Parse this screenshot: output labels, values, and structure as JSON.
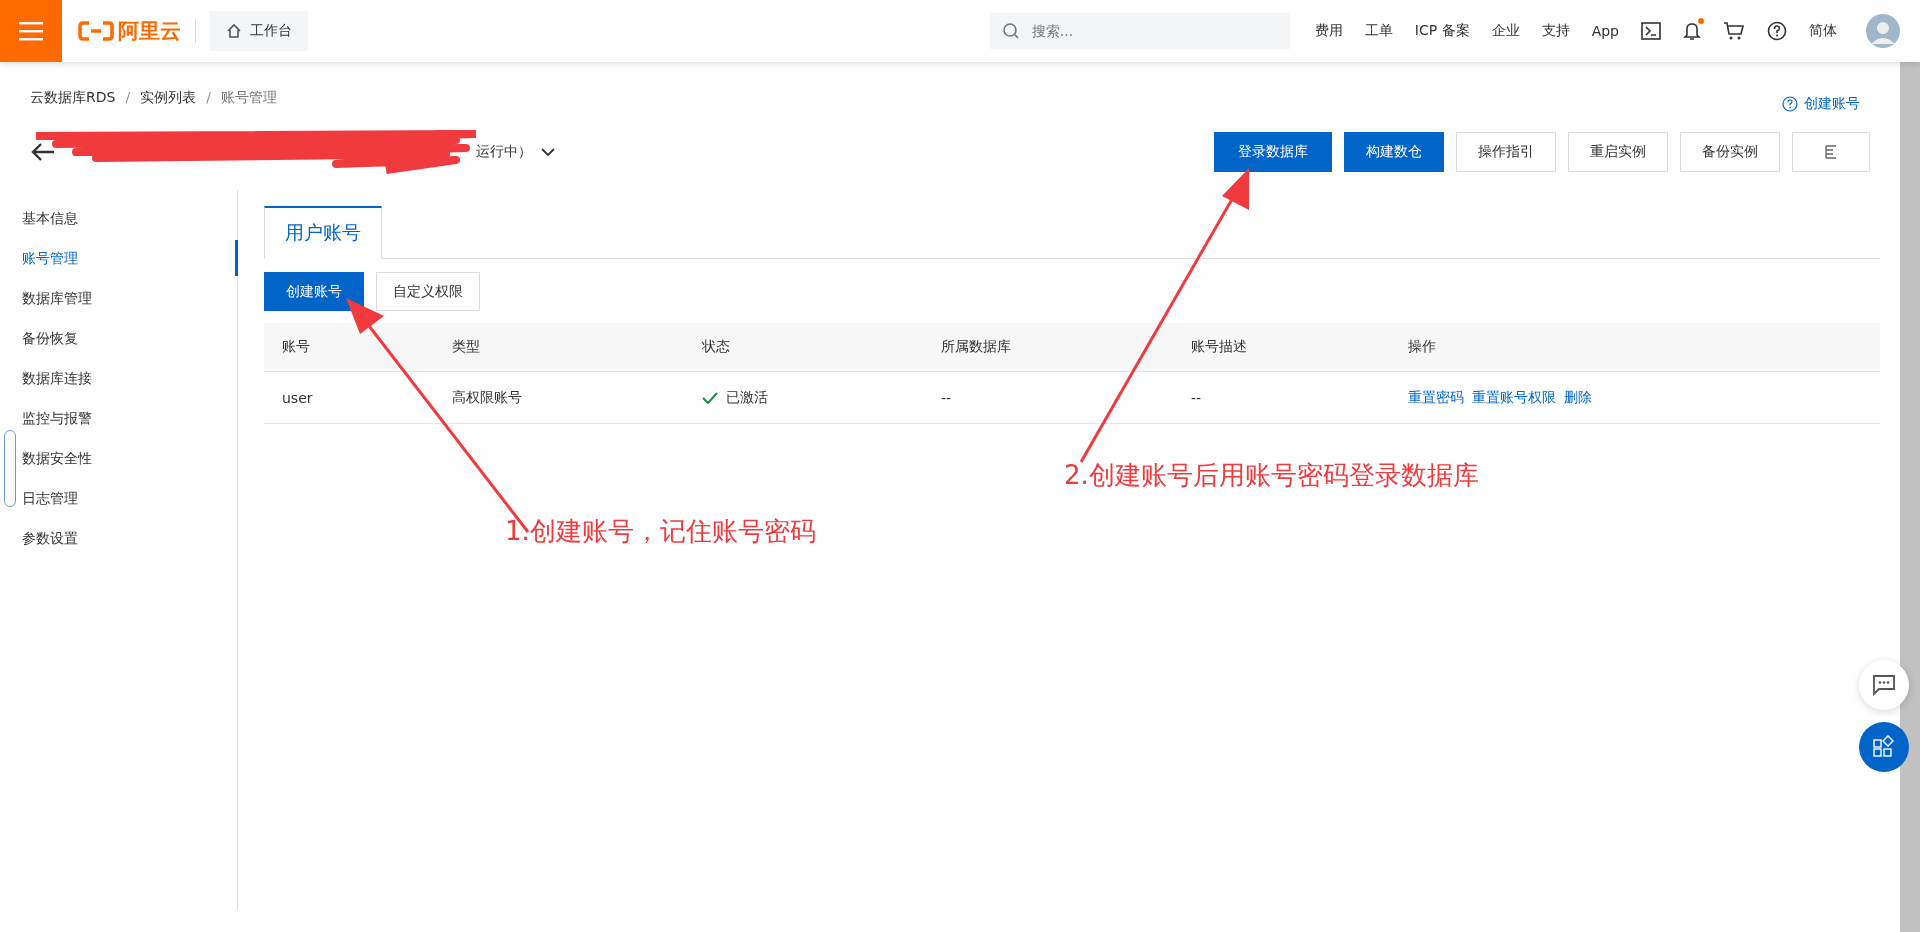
{
  "topbar": {
    "logo": "阿里云",
    "workbench": "工作台",
    "search": {
      "placeholder": "搜索..."
    },
    "links": [
      "费用",
      "工单",
      "ICP 备案",
      "企业",
      "支持",
      "App"
    ],
    "notification_dot": true,
    "language": "简体"
  },
  "breadcrumb": [
    {
      "label": "云数据库RDS"
    },
    {
      "separator": "/",
      "label": "实例列表"
    },
    {
      "separator": "/",
      "label": "账号管理"
    }
  ],
  "help_link": "创建账号",
  "instance": {
    "status": "运行中）"
  },
  "actions": [
    {
      "label": "登录数据库",
      "primary": true
    },
    {
      "label": "构建数仓",
      "primary": true
    },
    {
      "label": "操作指引",
      "primary": false
    },
    {
      "label": "重启实例",
      "primary": false
    },
    {
      "label": "备份实例",
      "primary": false
    }
  ],
  "sidebar": {
    "items": [
      {
        "label": "基本信息",
        "selected": false
      },
      {
        "label": "账号管理",
        "selected": true
      },
      {
        "label": "数据库管理",
        "selected": false
      },
      {
        "label": "备份恢复",
        "selected": false
      },
      {
        "label": "数据库连接",
        "selected": false
      },
      {
        "label": "监控与报警",
        "selected": false
      },
      {
        "label": "数据安全性",
        "selected": false
      },
      {
        "label": "日志管理",
        "selected": false
      },
      {
        "label": "参数设置",
        "selected": false
      }
    ]
  },
  "tabs": [
    {
      "label": "用户账号",
      "selected": true
    }
  ],
  "toolbar": [
    {
      "label": "创建账号",
      "primary": true
    },
    {
      "label": "自定义权限",
      "primary": false
    }
  ],
  "table": {
    "columns": [
      "账号",
      "类型",
      "状态",
      "所属数据库",
      "账号描述",
      "操作"
    ],
    "rows": [
      {
        "account": "user",
        "type": "高权限账号",
        "status": "已激活",
        "active": true,
        "database": "--",
        "description": "--",
        "operations": [
          "重置密码",
          "重置账号权限",
          "删除"
        ]
      }
    ]
  },
  "annotations": [
    "1.创建账号，记住账号密码",
    "2.创建账号后用账号密码登录数据库"
  ]
}
